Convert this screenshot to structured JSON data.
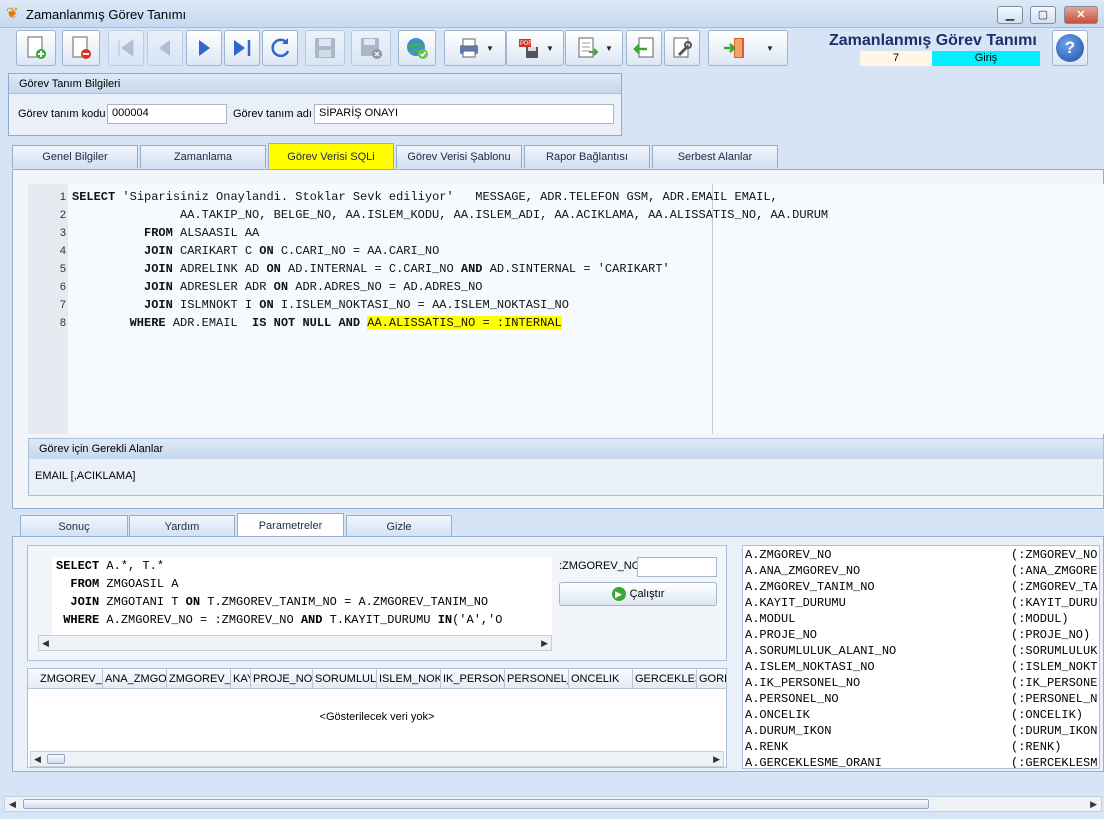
{
  "window": {
    "title": "Zamanlanmış Görev Tanımı",
    "minimize_label": "▁",
    "maximize_label": "▢",
    "close_label": "✕"
  },
  "header": {
    "title": "Zamanlanmış Görev Tanımı",
    "record_count": "7",
    "status": "Giriş",
    "help_label": "?"
  },
  "toolbar": {
    "buttons": [
      {
        "name": "new-record-button",
        "icon": "new-document-icon"
      },
      {
        "name": "delete-record-button",
        "icon": "delete-document-icon"
      },
      {
        "name": "first-record-button",
        "icon": "first-icon"
      },
      {
        "name": "previous-record-button",
        "icon": "previous-icon"
      },
      {
        "name": "next-record-button",
        "icon": "next-icon"
      },
      {
        "name": "last-record-button",
        "icon": "last-icon"
      },
      {
        "name": "refresh-button",
        "icon": "refresh-icon"
      },
      {
        "name": "save-button",
        "icon": "save-icon"
      },
      {
        "name": "cancel-save-button",
        "icon": "cancel-save-icon"
      },
      {
        "name": "web-button",
        "icon": "globe-icon"
      },
      {
        "name": "print-button",
        "icon": "printer-icon"
      },
      {
        "name": "pdf-export-button",
        "icon": "pdf-icon"
      },
      {
        "name": "export-button",
        "icon": "export-icon"
      },
      {
        "name": "import-button",
        "icon": "import-icon"
      },
      {
        "name": "tools-button",
        "icon": "tools-icon"
      },
      {
        "name": "exit-button",
        "icon": "exit-door-icon"
      }
    ]
  },
  "info": {
    "header": "Görev Tanım Bilgileri",
    "code_label": "Görev tanım kodu",
    "code_value": "000004",
    "name_label": "Görev tanım adı",
    "name_value": "SİPARİŞ ONAYI"
  },
  "main_tabs": [
    "Genel Bilgiler",
    "Zamanlama",
    "Görev Verisi SQLi",
    "Görev Verisi Şablonu",
    "Rapor Bağlantısı",
    "Serbest Alanlar"
  ],
  "sql_editor": {
    "line_numbers": [
      "1",
      "2",
      "3",
      "4",
      "5",
      "6",
      "7",
      "8"
    ],
    "lines": [
      [
        {
          "k": true,
          "t": "SELECT"
        },
        {
          "t": " 'Siparisiniz Onaylandi. Stoklar Sevk ediliyor'   MESSAGE, ADR.TELEFON GSM, ADR.EMAIL EMAIL,"
        }
      ],
      [
        {
          "t": "               AA.TAKIP_NO, BELGE_NO, AA.ISLEM_KODU, AA.ISLEM_ADI, AA.ACIKLAMA, AA.ALISSATIS_NO, AA.DURUM"
        }
      ],
      [
        {
          "t": "          "
        },
        {
          "k": true,
          "t": "FROM"
        },
        {
          "t": " ALSAASIL AA"
        }
      ],
      [
        {
          "t": "          "
        },
        {
          "k": true,
          "t": "JOIN"
        },
        {
          "t": " CARIKART C "
        },
        {
          "k": true,
          "t": "ON"
        },
        {
          "t": " C.CARI_NO = AA.CARI_NO"
        }
      ],
      [
        {
          "t": "          "
        },
        {
          "k": true,
          "t": "JOIN"
        },
        {
          "t": " ADRELINK AD "
        },
        {
          "k": true,
          "t": "ON"
        },
        {
          "t": " AD.INTERNAL = C.CARI_NO "
        },
        {
          "k": true,
          "t": "AND"
        },
        {
          "t": " AD.SINTERNAL = 'CARIKART'"
        }
      ],
      [
        {
          "t": "          "
        },
        {
          "k": true,
          "t": "JOIN"
        },
        {
          "t": " ADRESLER ADR "
        },
        {
          "k": true,
          "t": "ON"
        },
        {
          "t": " ADR.ADRES_NO = AD.ADRES_NO"
        }
      ],
      [
        {
          "t": "          "
        },
        {
          "k": true,
          "t": "JOIN"
        },
        {
          "t": " ISLMNOKT I "
        },
        {
          "k": true,
          "t": "ON"
        },
        {
          "t": " I.ISLEM_NOKTASI_NO = AA.ISLEM_NOKTASI_NO"
        }
      ],
      [
        {
          "t": "        "
        },
        {
          "k": true,
          "t": "WHERE"
        },
        {
          "t": " ADR.EMAIL  "
        },
        {
          "k": true,
          "t": "IS NOT NULL AND"
        },
        {
          "t": " "
        },
        {
          "h": true,
          "t": "AA.ALISSATIS_NO = :INTERNAL"
        }
      ]
    ]
  },
  "required_fields": {
    "header": "Görev için Gerekli Alanlar",
    "value": "EMAIL [,ACIKLAMA]"
  },
  "lower_tabs": [
    "Sonuç",
    "Yardım",
    "Parametreler",
    "Gizle"
  ],
  "params": {
    "sql_lines": [
      [
        {
          "k": true,
          "t": "SELECT"
        },
        {
          "t": " A.*, T.*"
        }
      ],
      [
        {
          "t": "  "
        },
        {
          "k": true,
          "t": "FROM"
        },
        {
          "t": " ZMGOASIL A"
        }
      ],
      [
        {
          "t": "  "
        },
        {
          "k": true,
          "t": "JOIN"
        },
        {
          "t": " ZMGOTANI T "
        },
        {
          "k": true,
          "t": "ON"
        },
        {
          "t": " T.ZMGOREV_TANIM_NO = A.ZMGOREV_TANIM_NO"
        }
      ],
      [
        {
          "t": " "
        },
        {
          "k": true,
          "t": "WHERE"
        },
        {
          "t": " A.ZMGOREV_NO = :ZMGOREV_NO "
        },
        {
          "k": true,
          "t": "AND"
        },
        {
          "t": " T.KAYIT_DURUMU "
        },
        {
          "k": true,
          "t": "IN"
        },
        {
          "t": "('A','O"
        }
      ]
    ],
    "param_label": ":ZMGOREV_NO",
    "param_value": "",
    "run_label": "Çalıştır"
  },
  "grid": {
    "columns": [
      "ZMGOREV_N",
      "ANA_ZMGOF",
      "ZMGOREV_T",
      "KAY",
      "PROJE_NO",
      "SORUMLULU",
      "ISLEM_NOKT",
      "IK_PERSONE",
      "PERSONEL_I",
      "ONCELIK",
      "GERCEKLESM",
      "GORI"
    ],
    "empty_text": "<Gösterilecek veri yok>"
  },
  "field_list": [
    [
      "A.ZMGOREV_NO",
      "(:ZMGOREV_NO"
    ],
    [
      "A.ANA_ZMGOREV_NO",
      "(:ANA_ZMGORE"
    ],
    [
      "A.ZMGOREV_TANIM_NO",
      "(:ZMGOREV_TA"
    ],
    [
      "A.KAYIT_DURUMU",
      "(:KAYIT_DURU"
    ],
    [
      "A.MODUL",
      "(:MODUL)"
    ],
    [
      "A.PROJE_NO",
      "(:PROJE_NO)"
    ],
    [
      "A.SORUMLULUK_ALANI_NO",
      "(:SORUMLULUK"
    ],
    [
      "A.ISLEM_NOKTASI_NO",
      "(:ISLEM_NOKT"
    ],
    [
      "A.IK_PERSONEL_NO",
      "(:IK_PERSONE"
    ],
    [
      "A.PERSONEL_NO",
      "(:PERSONEL_N"
    ],
    [
      "A.ONCELIK",
      "(:ONCELIK)"
    ],
    [
      "A.DURUM_IKON",
      "(:DURUM_IKON"
    ],
    [
      "A.RENK",
      "(:RENK)"
    ],
    [
      "A.GERCEKLESME_ORANI",
      "(:GERCEKLESM"
    ]
  ],
  "colors": {
    "active_tab": "#ffff00",
    "status_bg": "#00f0ff",
    "title": "#1a2f6b"
  }
}
